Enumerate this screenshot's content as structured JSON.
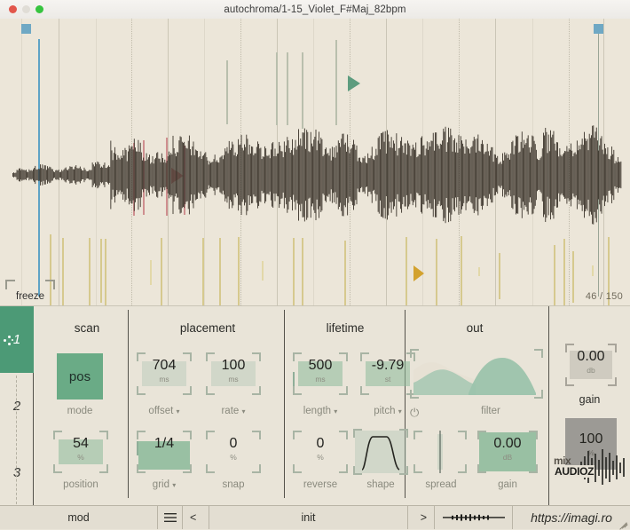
{
  "window": {
    "title": "autochroma/1-15_Violet_F#Maj_82bpm",
    "traffic_lights": [
      "close",
      "minimize",
      "zoom"
    ]
  },
  "waveform": {
    "freeze_label": "freeze",
    "counter": "46 / 150"
  },
  "layers": [
    {
      "label": "1",
      "active": true
    },
    {
      "label": "2",
      "active": false
    },
    {
      "label": "3",
      "active": false
    }
  ],
  "sections": [
    {
      "title": "scan"
    },
    {
      "title": "placement"
    },
    {
      "title": "lifetime"
    },
    {
      "title": "out"
    }
  ],
  "params": {
    "mode": {
      "label": "mode",
      "value": "pos",
      "unit": ""
    },
    "offset": {
      "label": "offset",
      "value": "704",
      "unit": "ms",
      "caret": true
    },
    "rate": {
      "label": "rate",
      "value": "100",
      "unit": "ms",
      "caret": true
    },
    "length": {
      "label": "length",
      "value": "500",
      "unit": "ms",
      "caret": true
    },
    "pitch": {
      "label": "pitch",
      "value": "-9.79",
      "unit": "st",
      "caret": true
    },
    "filter": {
      "label": "filter",
      "value": "",
      "unit": ""
    },
    "position": {
      "label": "position",
      "value": "54",
      "unit": "%"
    },
    "grid": {
      "label": "grid",
      "value": "1/4",
      "unit": "",
      "caret": true
    },
    "snap": {
      "label": "snap",
      "value": "0",
      "unit": "%"
    },
    "reverse": {
      "label": "reverse",
      "value": "0",
      "unit": "%"
    },
    "shape": {
      "label": "shape",
      "value": "",
      "unit": ""
    },
    "spread": {
      "label": "spread",
      "value": "",
      "unit": ""
    },
    "out_gain": {
      "label": "gain",
      "value": "0.00",
      "unit": "dB"
    }
  },
  "master": {
    "gain_label": "gain",
    "gain_value": "0.00",
    "gain_unit": "db",
    "mix_value": "100",
    "mix_unit": "%"
  },
  "watermark": {
    "line1": "mix",
    "line2": "AUDIOZ"
  },
  "bottom_bar": {
    "mod": "mod",
    "menu_icon": "hamburger-icon",
    "prev": "<",
    "preset": "init",
    "next": ">",
    "url": "https://imagi.ro"
  },
  "colors": {
    "accent_green": "#4c9a76",
    "panel_bg": "#e9e4d8",
    "wave_bg": "#ece6d9",
    "waveform": "#3a332a",
    "marker_blue": "#6fa8c4",
    "marker_red": "#cf8f8f",
    "marker_gold": "#d3a22e"
  }
}
